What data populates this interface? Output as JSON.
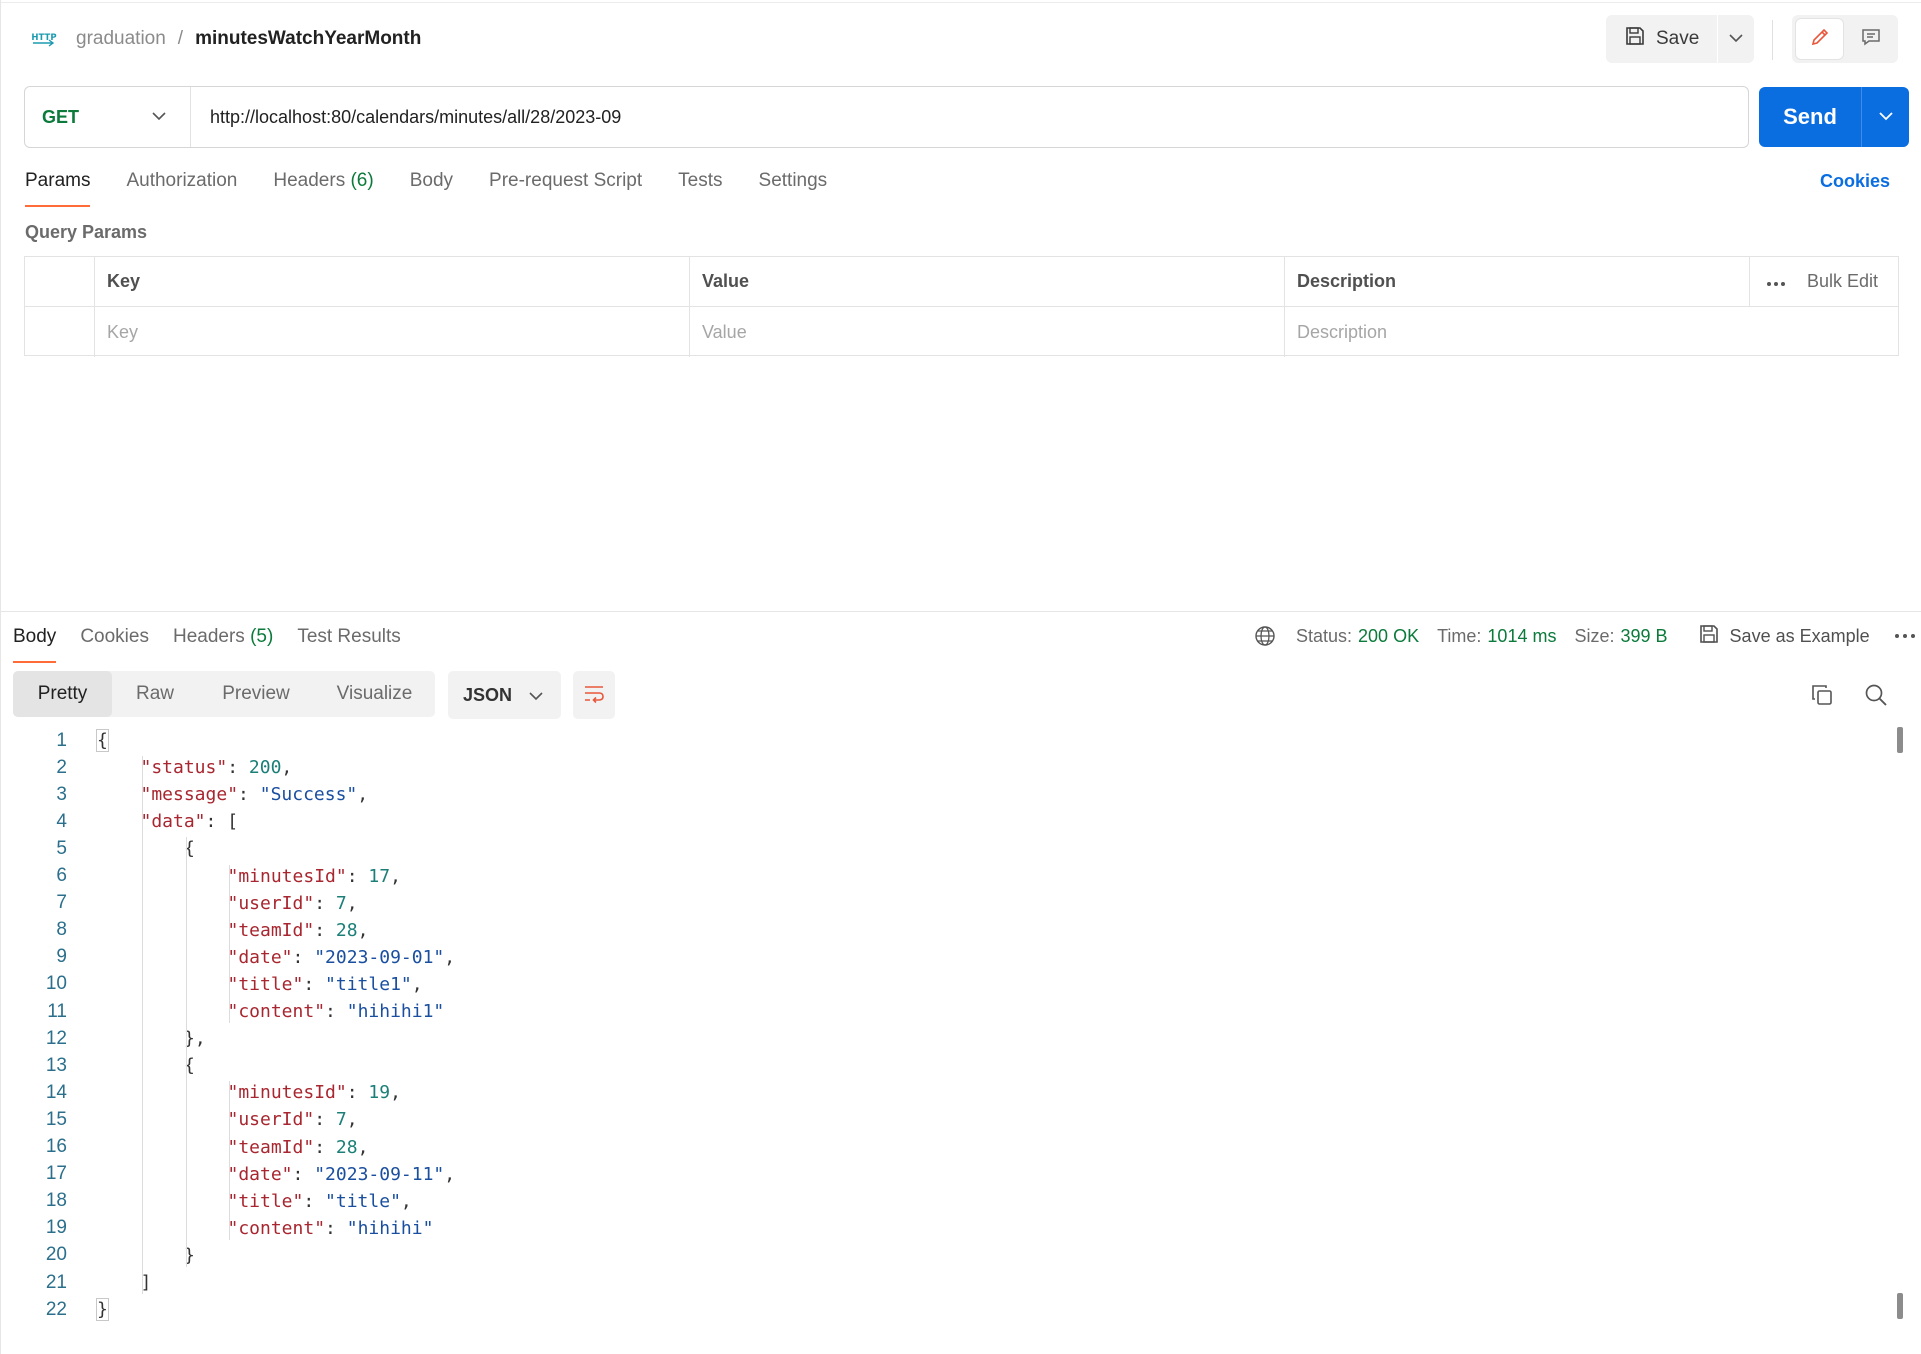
{
  "breadcrumb": {
    "collection": "graduation",
    "separator": "/",
    "request_name": "minutesWatchYearMonth"
  },
  "header": {
    "save_label": "Save"
  },
  "request": {
    "method": "GET",
    "url": "http://localhost:80/calendars/minutes/all/28/2023-09",
    "send_label": "Send"
  },
  "request_tabs": [
    {
      "label": "Params",
      "count": ""
    },
    {
      "label": "Authorization",
      "count": ""
    },
    {
      "label": "Headers",
      "count": "(6)"
    },
    {
      "label": "Body",
      "count": ""
    },
    {
      "label": "Pre-request Script",
      "count": ""
    },
    {
      "label": "Tests",
      "count": ""
    },
    {
      "label": "Settings",
      "count": ""
    }
  ],
  "cookies_link": "Cookies",
  "query_params": {
    "label": "Query Params",
    "headers": {
      "key": "Key",
      "value": "Value",
      "description": "Description",
      "bulk_edit": "Bulk Edit"
    },
    "placeholders": {
      "key": "Key",
      "value": "Value",
      "description": "Description"
    }
  },
  "response_tabs": [
    {
      "label": "Body",
      "count": ""
    },
    {
      "label": "Cookies",
      "count": ""
    },
    {
      "label": "Headers",
      "count": "(5)"
    },
    {
      "label": "Test Results",
      "count": ""
    }
  ],
  "response_meta": {
    "status_label": "Status:",
    "status_value": "200 OK",
    "time_label": "Time:",
    "time_value": "1014 ms",
    "size_label": "Size:",
    "size_value": "399 B",
    "save_example": "Save as Example"
  },
  "view_modes": [
    "Pretty",
    "Raw",
    "Preview",
    "Visualize"
  ],
  "format": "JSON",
  "code_lines": [
    [
      [
        "p",
        "{"
      ]
    ],
    [
      [
        "k",
        "\"status\""
      ],
      [
        "p",
        ": "
      ],
      [
        "n",
        "200"
      ],
      [
        "p",
        ","
      ]
    ],
    [
      [
        "k",
        "\"message\""
      ],
      [
        "p",
        ": "
      ],
      [
        "s",
        "\"Success\""
      ],
      [
        "p",
        ","
      ]
    ],
    [
      [
        "k",
        "\"data\""
      ],
      [
        "p",
        ": ["
      ]
    ],
    [
      [
        "p",
        "{"
      ]
    ],
    [
      [
        "k",
        "\"minutesId\""
      ],
      [
        "p",
        ": "
      ],
      [
        "n",
        "17"
      ],
      [
        "p",
        ","
      ]
    ],
    [
      [
        "k",
        "\"userId\""
      ],
      [
        "p",
        ": "
      ],
      [
        "n",
        "7"
      ],
      [
        "p",
        ","
      ]
    ],
    [
      [
        "k",
        "\"teamId\""
      ],
      [
        "p",
        ": "
      ],
      [
        "n",
        "28"
      ],
      [
        "p",
        ","
      ]
    ],
    [
      [
        "k",
        "\"date\""
      ],
      [
        "p",
        ": "
      ],
      [
        "s",
        "\"2023-09-01\""
      ],
      [
        "p",
        ","
      ]
    ],
    [
      [
        "k",
        "\"title\""
      ],
      [
        "p",
        ": "
      ],
      [
        "s",
        "\"title1\""
      ],
      [
        "p",
        ","
      ]
    ],
    [
      [
        "k",
        "\"content\""
      ],
      [
        "p",
        ": "
      ],
      [
        "s",
        "\"hihihi1\""
      ]
    ],
    [
      [
        "p",
        "},"
      ]
    ],
    [
      [
        "p",
        "{"
      ]
    ],
    [
      [
        "k",
        "\"minutesId\""
      ],
      [
        "p",
        ": "
      ],
      [
        "n",
        "19"
      ],
      [
        "p",
        ","
      ]
    ],
    [
      [
        "k",
        "\"userId\""
      ],
      [
        "p",
        ": "
      ],
      [
        "n",
        "7"
      ],
      [
        "p",
        ","
      ]
    ],
    [
      [
        "k",
        "\"teamId\""
      ],
      [
        "p",
        ": "
      ],
      [
        "n",
        "28"
      ],
      [
        "p",
        ","
      ]
    ],
    [
      [
        "k",
        "\"date\""
      ],
      [
        "p",
        ": "
      ],
      [
        "s",
        "\"2023-09-11\""
      ],
      [
        "p",
        ","
      ]
    ],
    [
      [
        "k",
        "\"title\""
      ],
      [
        "p",
        ": "
      ],
      [
        "s",
        "\"title\""
      ],
      [
        "p",
        ","
      ]
    ],
    [
      [
        "k",
        "\"content\""
      ],
      [
        "p",
        ": "
      ],
      [
        "s",
        "\"hihihi\""
      ]
    ],
    [
      [
        "p",
        "}"
      ]
    ],
    [
      [
        "p",
        "]"
      ]
    ],
    [
      [
        "p",
        "}"
      ]
    ]
  ],
  "code_indent": [
    0,
    1,
    1,
    1,
    2,
    3,
    3,
    3,
    3,
    3,
    3,
    2,
    2,
    3,
    3,
    3,
    3,
    3,
    3,
    2,
    1,
    0
  ]
}
